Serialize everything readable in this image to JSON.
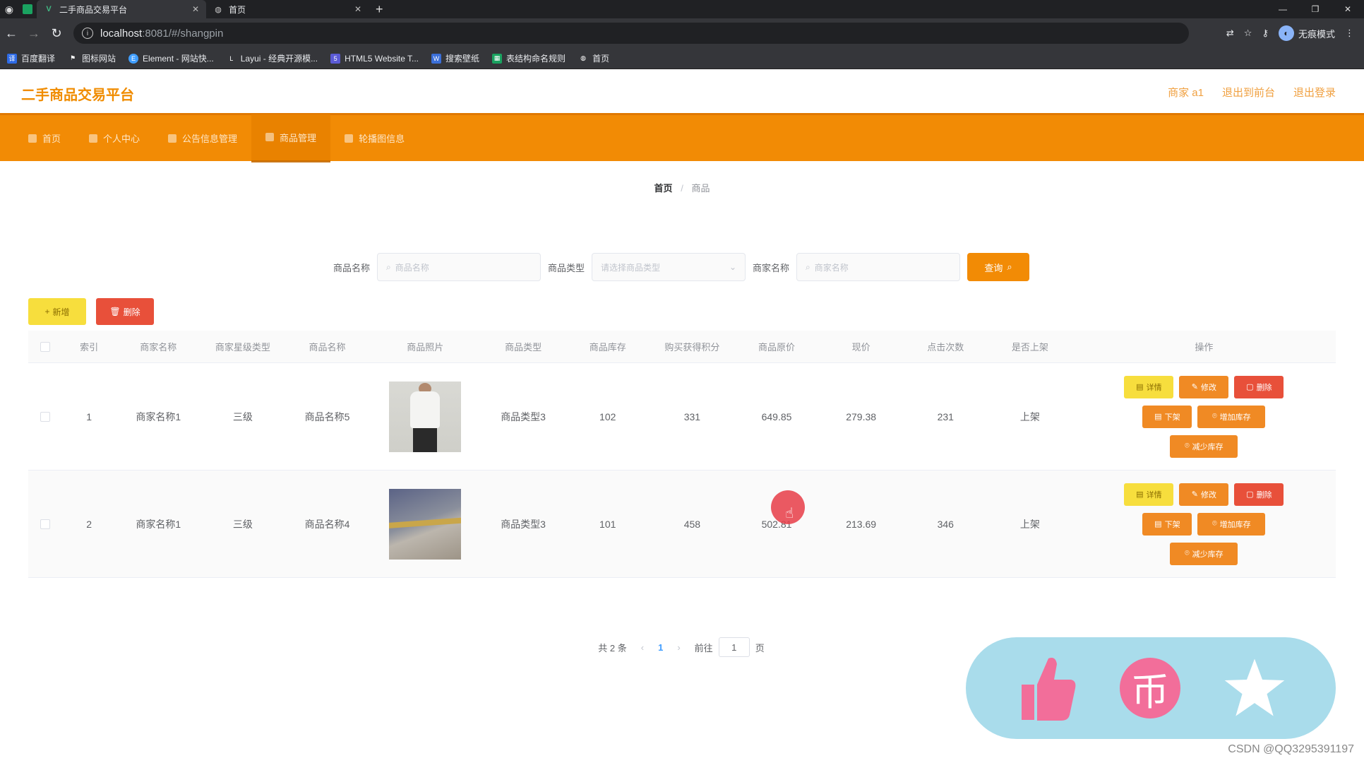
{
  "browser": {
    "tabs": [
      {
        "title": "二手商品交易平台",
        "active": true
      },
      {
        "title": "首页",
        "active": false
      }
    ],
    "url_host": "localhost",
    "url_path": ":8081/#/shangpin",
    "incognito_label": "无痕模式",
    "bookmarks": [
      {
        "label": "百度翻译",
        "icon": "baidu-translate-icon"
      },
      {
        "label": "图标网站",
        "icon": "flag-icon"
      },
      {
        "label": "Element - 网站快...",
        "icon": "element-icon"
      },
      {
        "label": "Layui - 经典开源模...",
        "icon": "layui-icon"
      },
      {
        "label": "HTML5 Website T...",
        "icon": "html5-icon"
      },
      {
        "label": "搜索壁纸",
        "icon": "wallpaper-icon"
      },
      {
        "label": "表结构命名规则",
        "icon": "table-icon"
      },
      {
        "label": "首页",
        "icon": "globe-icon"
      }
    ]
  },
  "app": {
    "brand": "二手商品交易平台",
    "header_links": [
      "商家 a1",
      "退出到前台",
      "退出登录"
    ],
    "menu": [
      {
        "label": "首页",
        "active": false
      },
      {
        "label": "个人中心",
        "active": false
      },
      {
        "label": "公告信息管理",
        "active": false
      },
      {
        "label": "商品管理",
        "active": true
      },
      {
        "label": "轮播图信息",
        "active": false
      }
    ],
    "breadcrumb": {
      "home": "首页",
      "sep": "/",
      "current": "商品"
    },
    "search": {
      "name_label": "商品名称",
      "name_placeholder": "商品名称",
      "type_label": "商品类型",
      "type_placeholder": "请选择商品类型",
      "merchant_label": "商家名称",
      "merchant_placeholder": "商家名称",
      "query_label": "查询"
    },
    "actions": {
      "add": "新增",
      "delete": "删除"
    },
    "table": {
      "headers": [
        "索引",
        "商家名称",
        "商家星级类型",
        "商品名称",
        "商品照片",
        "商品类型",
        "商品库存",
        "购买获得积分",
        "商品原价",
        "现价",
        "点击次数",
        "是否上架",
        "操作"
      ],
      "rows": [
        {
          "index": "1",
          "merchant": "商家名称1",
          "level": "三级",
          "name": "商品名称5",
          "type": "商品类型3",
          "stock": "102",
          "points": "331",
          "original_price": "649.85",
          "price": "279.38",
          "clicks": "231",
          "listed": "上架"
        },
        {
          "index": "2",
          "merchant": "商家名称1",
          "level": "三级",
          "name": "商品名称4",
          "type": "商品类型3",
          "stock": "101",
          "points": "458",
          "original_price": "502.81",
          "price": "213.69",
          "clicks": "346",
          "listed": "上架"
        }
      ],
      "row_actions": {
        "detail": "详情",
        "edit": "修改",
        "delete": "删除",
        "unlist": "下架",
        "add_stock": "增加库存",
        "reduce_stock": "减少库存"
      }
    },
    "pagination": {
      "total": "共 2 条",
      "current": "1",
      "goto_label": "前往",
      "goto_value": "1",
      "page_suffix": "页"
    }
  },
  "watermark": "CSDN @QQ3295391197",
  "colors": {
    "accent": "#f28b05",
    "danger": "#e8503a",
    "warning": "#f7de3d",
    "overlay": "#a9dceb"
  }
}
